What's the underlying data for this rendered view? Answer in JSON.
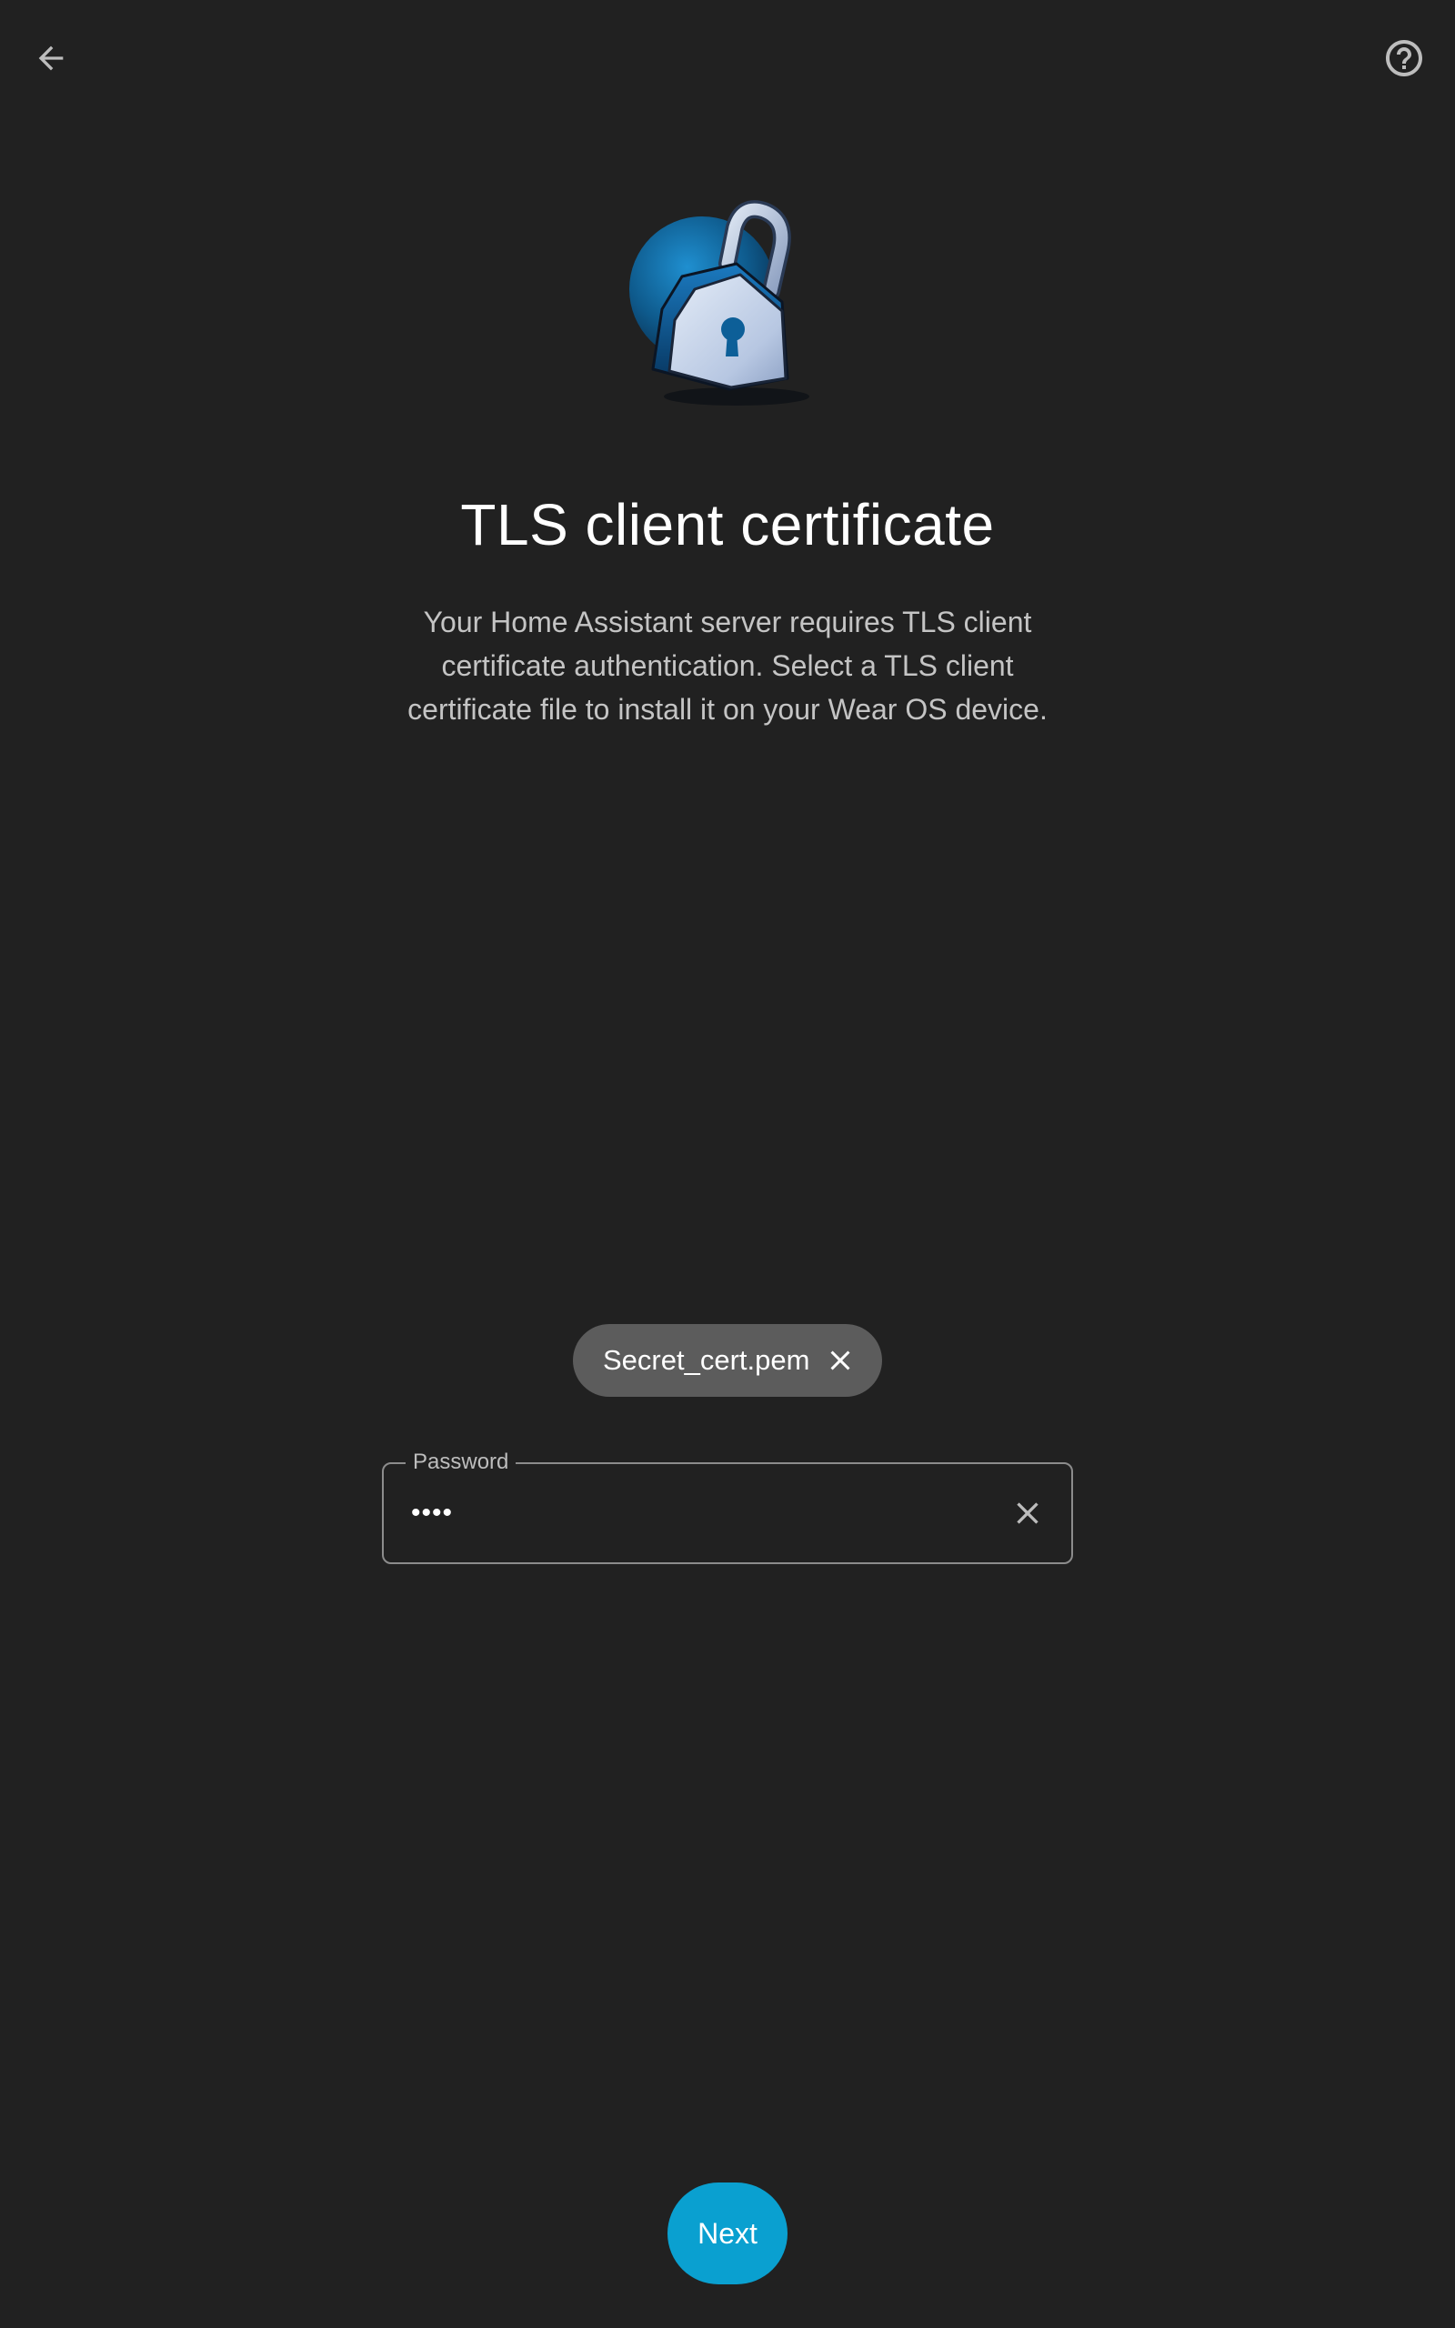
{
  "header": {
    "back_icon": "arrow-back-icon",
    "help_icon": "help-circle-icon"
  },
  "hero": {
    "icon": "padlock-icon"
  },
  "title": "TLS client certificate",
  "description": "Your Home Assistant server requires TLS client certificate authentication. Select a TLS client certificate file to install it on your Wear OS device.",
  "certificate_chip": {
    "label": "Secret_cert.pem",
    "close_icon": "close-icon"
  },
  "password_field": {
    "label": "Password",
    "value": "••••",
    "clear_icon": "close-icon"
  },
  "next_button": {
    "label": "Next"
  },
  "colors": {
    "background": "#212121",
    "accent": "#0aa0d0",
    "chip": "#5c5c5c",
    "secondary_text": "#c4c4c4"
  }
}
